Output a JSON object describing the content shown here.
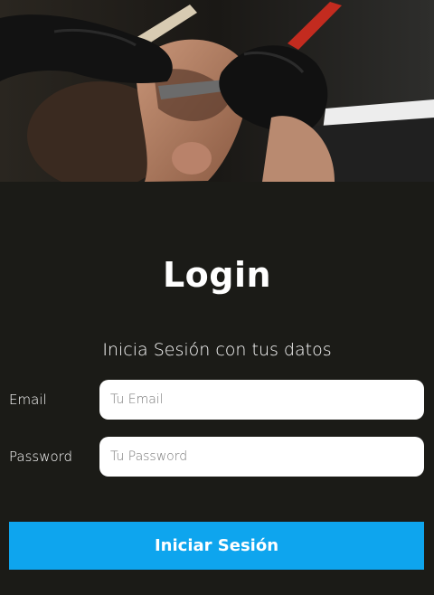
{
  "hero": {
    "image": "barber-shaving-photo"
  },
  "login": {
    "title": "Login",
    "subtitle": "Inicia Sesión con tus datos",
    "email": {
      "label": "Email",
      "placeholder": "Tu Email",
      "value": ""
    },
    "password": {
      "label": "Password",
      "placeholder": "Tu Password",
      "value": ""
    },
    "submit_label": "Iniciar Sesión"
  },
  "colors": {
    "background": "#1b1b17",
    "button": "#0ea5ee",
    "input_background": "#ffffff",
    "text": "#ffffff"
  }
}
